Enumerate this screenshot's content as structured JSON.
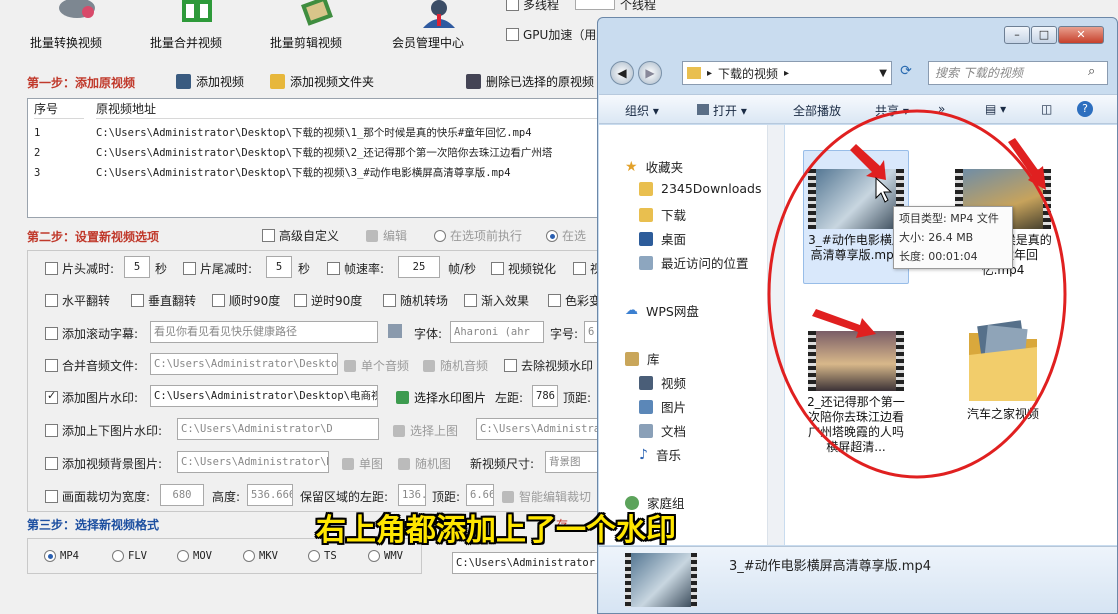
{
  "toolbar": [
    {
      "label": "批量转换视频"
    },
    {
      "label": "批量合并视频"
    },
    {
      "label": "批量剪辑视频"
    },
    {
      "label": "会员管理中心"
    }
  ],
  "top_options": {
    "threads": "多线程",
    "threads_unit": "个线程",
    "gpu": "GPU加速（用显"
  },
  "step1": {
    "title": "第一步：添加原视频",
    "add_video": "添加视频",
    "add_folder": "添加视频文件夹",
    "delete_selected": "删除已选择的原视频"
  },
  "table": {
    "headers": [
      "序号",
      "原视频地址"
    ],
    "rows": [
      {
        "num": "1",
        "path": "C:\\Users\\Administrator\\Desktop\\下载的视频\\1_那个时候是真的快乐#童年回忆.mp4"
      },
      {
        "num": "2",
        "path": "C:\\Users\\Administrator\\Desktop\\下载的视频\\2_还记得那个第一次陪你去珠江边看广州塔"
      },
      {
        "num": "3",
        "path": "C:\\Users\\Administrator\\Desktop\\下载的视频\\3_#动作电影横屏高清尊享版.mp4"
      }
    ]
  },
  "step2": {
    "title": "第二步：设置新视频选项",
    "advanced": "高级自定义",
    "edit": "编辑",
    "exec_before": "在选项前执行",
    "exec_after": "在选"
  },
  "options": {
    "head_cut": "片头减时:",
    "head_val": "5",
    "sec": "秒",
    "tail_cut": "片尾减时:",
    "tail_val": "5",
    "fps_cut": "帧速率:",
    "fps_val": "25",
    "fps_unit": "帧/秒",
    "sharpen": "视频锐化",
    "sharpen_more": "视",
    "hflip": "水平翻转",
    "vflip": "垂直翻转",
    "cw90": "顺时90度",
    "ccw90": "逆时90度",
    "random_trans": "随机转场",
    "fade_in": "渐入效果",
    "color": "色彩变",
    "scroll_sub": "添加滚动字幕:",
    "scroll_text": "看见你看见看见快乐健康路径",
    "font_label": "字体:",
    "font_val": "Aharoni (ahr",
    "size_label": "字号:",
    "size_val": "6",
    "merge_audio": "合并音频文件:",
    "audio_path": "C:\\Users\\Administrator\\Deskto",
    "single_audio": "单个音频",
    "random_audio": "随机音频",
    "remove_watermark": "去除视频水印",
    "img_watermark": "添加图片水印:",
    "img_path": "C:\\Users\\Administrator\\Desktop\\电商视",
    "choose_watermark": "选择水印图片",
    "left_label": "左距:",
    "left_val": "786",
    "top_label": "顶距:",
    "updown_watermark": "添加上下图片水印:",
    "updown_path": "C:\\Users\\Administrator\\D",
    "choose_top": "选择上图",
    "updown_path2": "C:\\Users\\Administra",
    "bg_image": "添加视频背景图片:",
    "bg_path": "C:\\Users\\Administrator\\D",
    "single_img": "单图",
    "random_img": "随机图",
    "new_size": "新视频尺寸:",
    "bg_mode": "背景图",
    "crop": "画面裁切为宽度:",
    "crop_w": "680",
    "height_label": "高度:",
    "crop_h": "536.666",
    "keep_left": "保留区域的左距:",
    "keep_left_val": "136.",
    "top_label2": "顶距:",
    "keep_top_val": "6.66",
    "smart_crop": "智能编辑裁切"
  },
  "step3": {
    "title": "第三步：选择新视频格式",
    "formats": [
      "MP4",
      "FLV",
      "MOV",
      "MKV",
      "TS",
      "WMV"
    ],
    "output_path": "C:\\Users\\Administrator",
    "save_partial": "存"
  },
  "explorer": {
    "address": [
      "下载的视频"
    ],
    "search_placeholder": "搜索 下载的视频",
    "commands": {
      "organize": "组织",
      "open": "打开",
      "play_all": "全部播放",
      "share": "共享",
      "more": "»"
    },
    "nav": {
      "favorites": "收藏夹",
      "items": [
        "2345Downloads",
        "下载",
        "桌面",
        "最近访问的位置"
      ],
      "wps": "WPS网盘",
      "library": "库",
      "lib_items": [
        "视频",
        "图片",
        "文档",
        "音乐"
      ],
      "homegroup": "家庭组"
    },
    "files": [
      {
        "name": "3_#动作电影横屏高清尊享版.mp4"
      },
      {
        "name": "1_那个时候是真的快乐#童年回忆.mp4"
      },
      {
        "name": "2_还记得那个第一次陪你去珠江边看广州塔晚霞的人吗横屏超清..."
      },
      {
        "name": "汽车之家视频"
      }
    ],
    "tooltip": {
      "type": "项目类型: MP4 文件",
      "size": "大小: 26.4 MB",
      "length": "长度: 00:01:04"
    },
    "details": {
      "filename": "3_#动作电影横屏高清尊享版.mp4"
    }
  },
  "subtitle": "右上角都添加上了一个水印",
  "colors": {
    "step_red": "#c0392b",
    "step_blue": "#1d4fa0",
    "annotation_red": "#e02020",
    "subtitle_yellow": "#ffe600"
  }
}
